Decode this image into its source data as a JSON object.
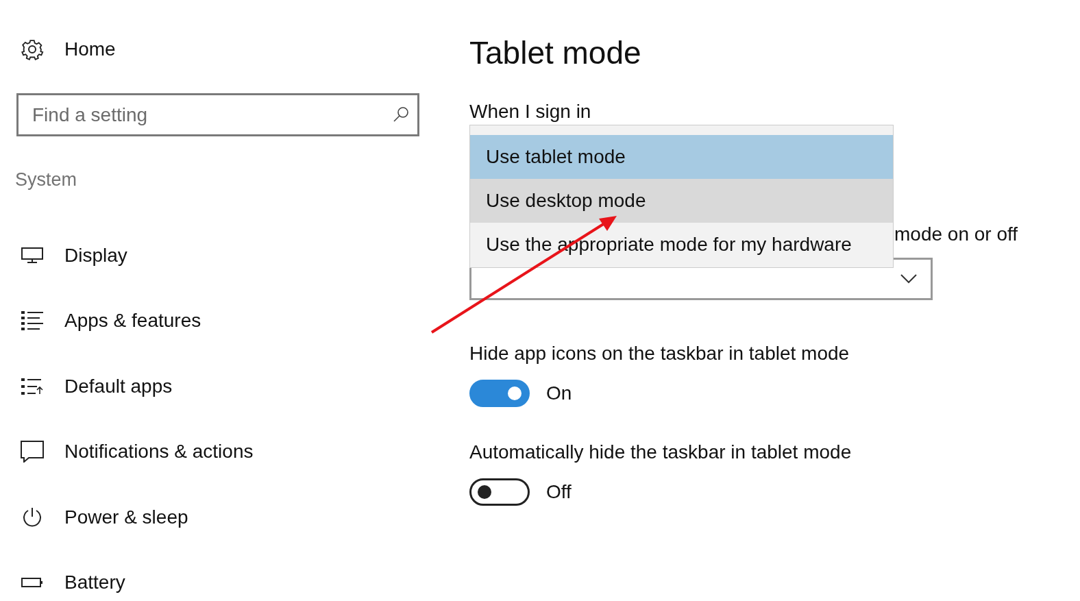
{
  "sidebar": {
    "home": "Home",
    "search": {
      "placeholder": "Find a setting"
    },
    "section": "System",
    "items": [
      {
        "kind": "display",
        "label": "Display"
      },
      {
        "kind": "apps",
        "label": "Apps & features"
      },
      {
        "kind": "defaults",
        "label": "Default apps"
      },
      {
        "kind": "notifications",
        "label": "Notifications & actions"
      },
      {
        "kind": "power",
        "label": "Power & sleep"
      },
      {
        "kind": "battery",
        "label": "Battery"
      }
    ]
  },
  "content": {
    "title": "Tablet mode",
    "sign_in_label": "When I sign in",
    "dropdown_options": [
      {
        "label": "Use tablet mode",
        "selected": true,
        "hovered": false
      },
      {
        "label": "Use desktop mode",
        "selected": false,
        "hovered": true
      },
      {
        "label": "Use the appropriate mode for my hardware",
        "selected": false,
        "hovered": false
      }
    ],
    "switch_label": "mode on or off",
    "toggles": [
      {
        "label": "Hide app icons on the taskbar in tablet mode",
        "on": true,
        "state": "On"
      },
      {
        "label": "Automatically hide the taskbar in tablet mode",
        "on": false,
        "state": "Off"
      }
    ]
  }
}
